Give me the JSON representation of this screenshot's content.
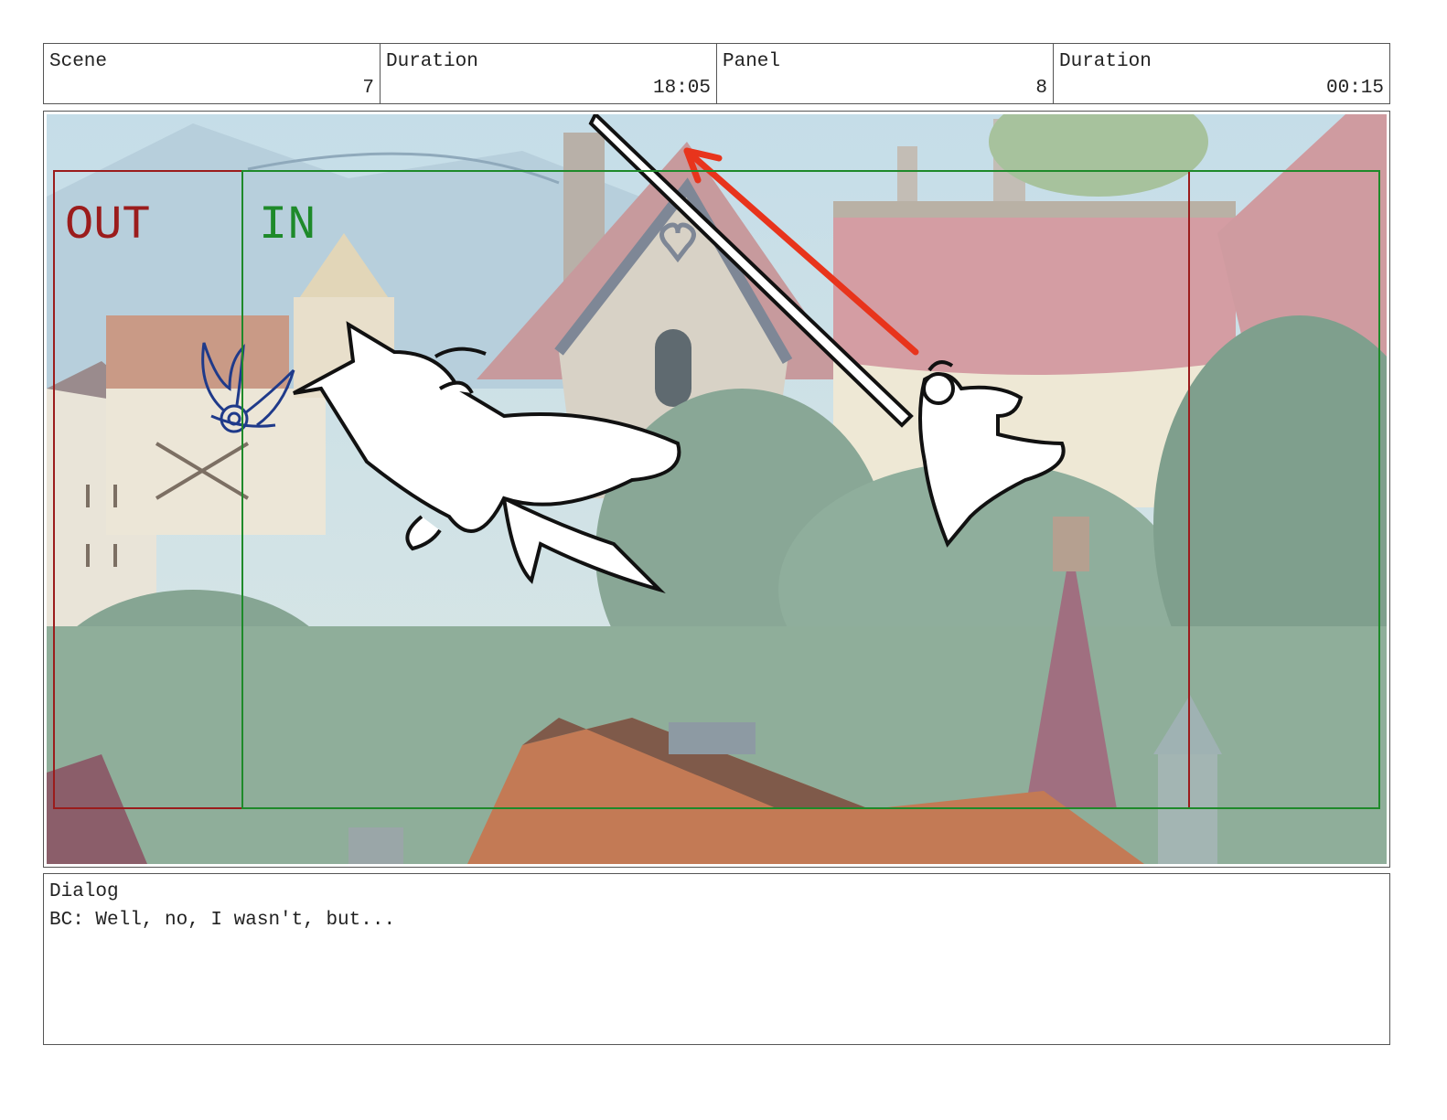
{
  "header": {
    "scene_label": "Scene",
    "scene_value": "7",
    "scene_duration_label": "Duration",
    "scene_duration_value": "18:05",
    "panel_label": "Panel",
    "panel_value": "8",
    "panel_duration_label": "Duration",
    "panel_duration_value": "00:15"
  },
  "frame": {
    "out_label": "OUT",
    "in_label": "IN",
    "out_color": "#9b1c1c",
    "in_color": "#1e8a2a",
    "motion_arrow_color": "#e8341c"
  },
  "dialog": {
    "label": "Dialog",
    "text": "BC: Well, no, I wasn't, but..."
  }
}
